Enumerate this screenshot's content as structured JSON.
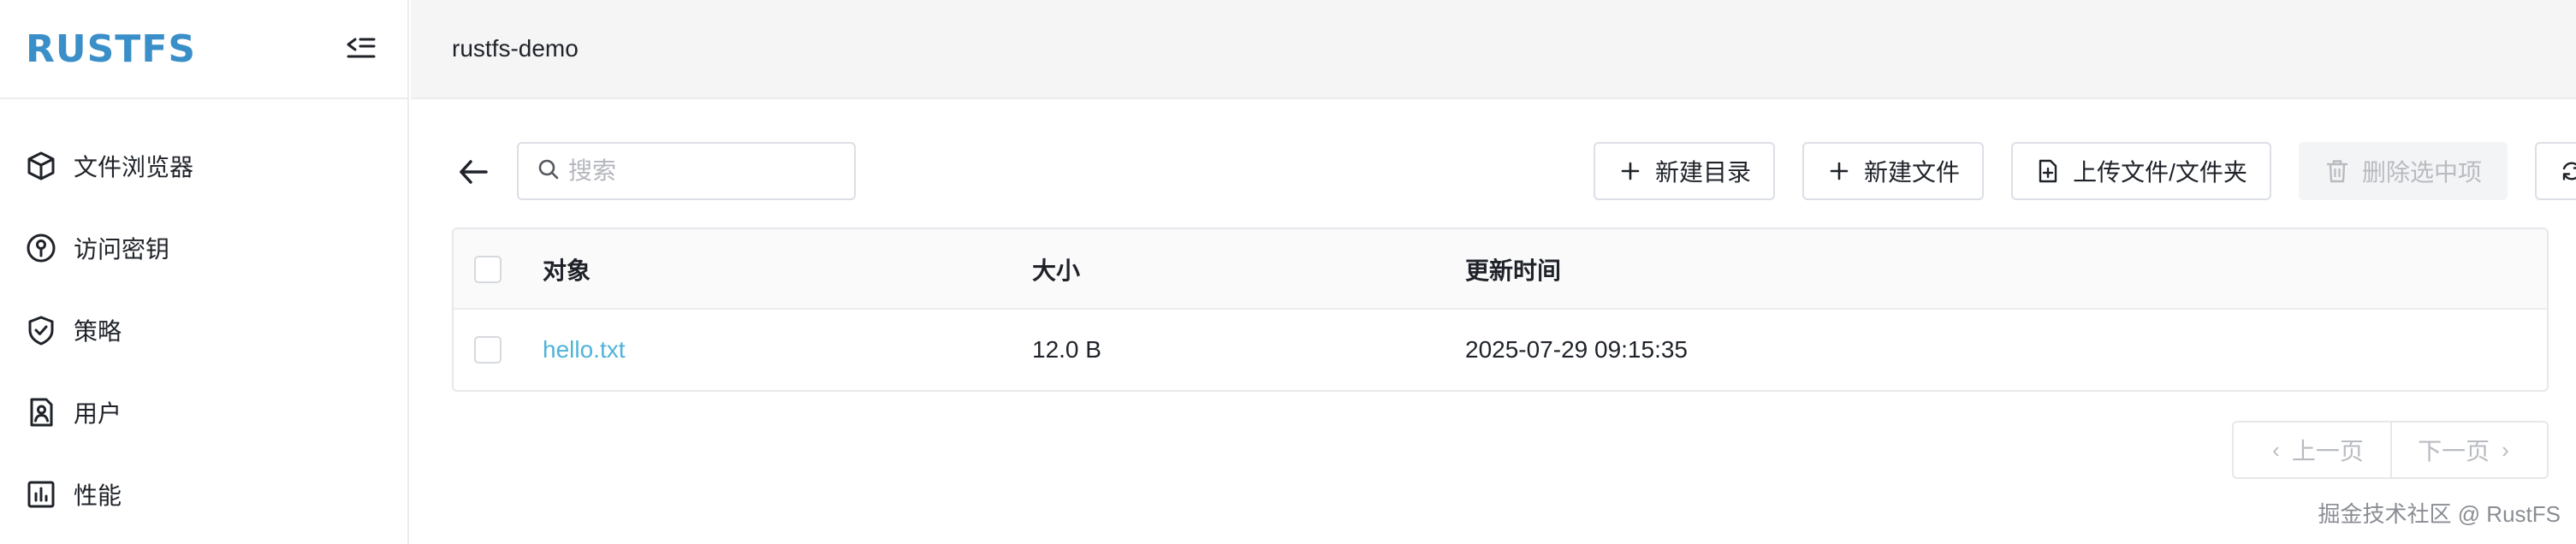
{
  "app": {
    "logo_text": "RUSTFS",
    "brand_color": "#3b8fc8"
  },
  "sidebar": {
    "collapse_icon": "sidebar-collapse-icon",
    "items": [
      {
        "label": "文件浏览器",
        "icon": "cube-icon"
      },
      {
        "label": "访问密钥",
        "icon": "key-circle-icon"
      },
      {
        "label": "策略",
        "icon": "shield-check-icon"
      },
      {
        "label": "用户",
        "icon": "user-card-icon"
      },
      {
        "label": "性能",
        "icon": "bar-chart-icon"
      }
    ]
  },
  "topbar": {
    "bucket_name": "rustfs-demo"
  },
  "toolbar": {
    "search_placeholder": "搜索",
    "new_dir_label": "新建目录",
    "new_file_label": "新建文件",
    "upload_label": "上传文件/文件夹",
    "delete_label": "删除选中项",
    "refresh_label": "刷新"
  },
  "table": {
    "headers": {
      "object": "对象",
      "size": "大小",
      "updated": "更新时间"
    },
    "rows": [
      {
        "name": "hello.txt",
        "size": "12.0 B",
        "updated": "2025-07-29 09:15:35"
      }
    ]
  },
  "pagination": {
    "prev_label": "上一页",
    "next_label": "下一页"
  },
  "watermark": "掘金技术社区 @ RustFS",
  "colors": {
    "link": "#4fb3d9",
    "disabled_text": "#b8bbc0",
    "border": "#dcdfe6"
  }
}
